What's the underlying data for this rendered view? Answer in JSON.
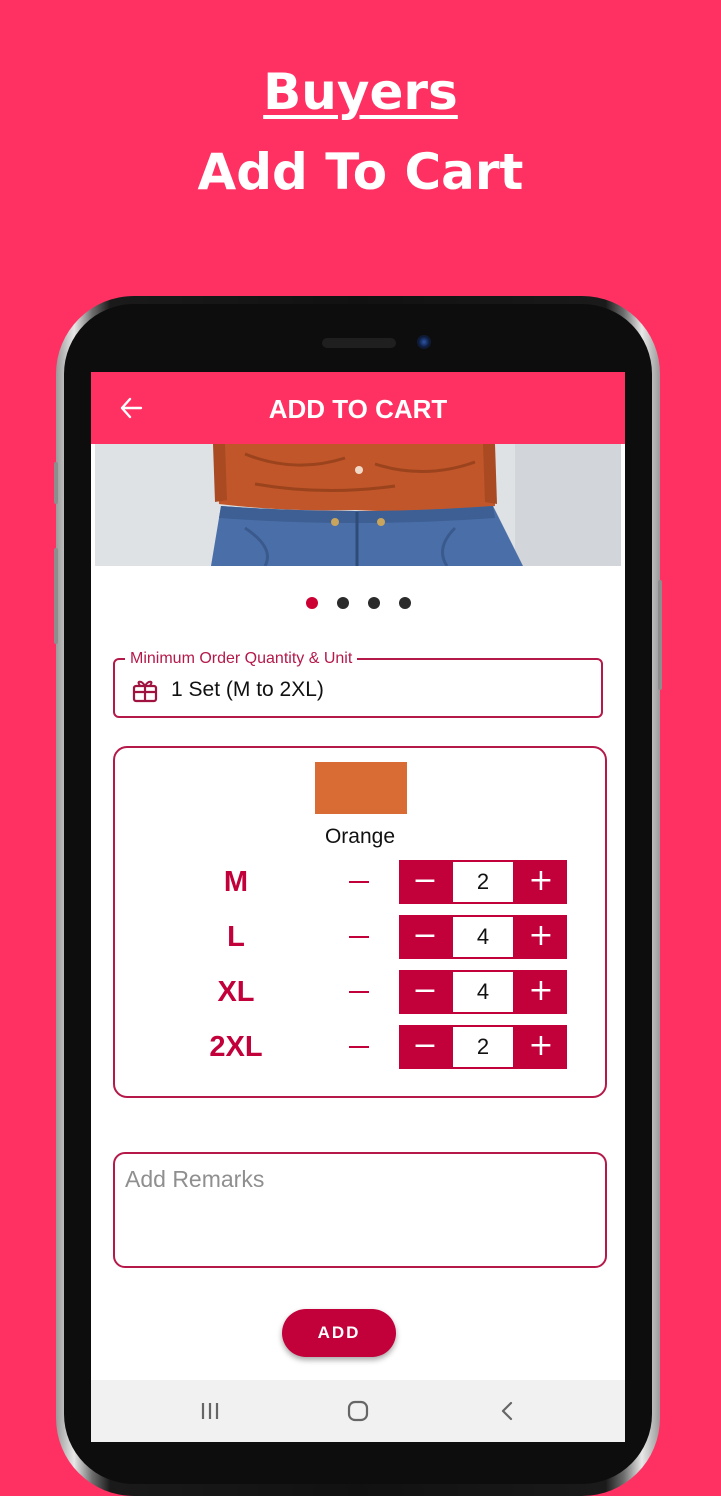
{
  "promo": {
    "line1": "Buyers",
    "line2": "Add To Cart"
  },
  "app_bar": {
    "title": "ADD TO CART",
    "back_icon": "arrow-left-icon"
  },
  "carousel": {
    "count": 4,
    "active_index": 0
  },
  "min_order": {
    "label": "Minimum Order Quantity & Unit",
    "value": "1 Set (M to 2XL)",
    "icon": "gift-icon"
  },
  "variant": {
    "color_name": "Orange",
    "swatch_color": "#d96b34",
    "sizes": [
      {
        "label": "M",
        "quantity": "2"
      },
      {
        "label": "L",
        "quantity": "4"
      },
      {
        "label": "XL",
        "quantity": "4"
      },
      {
        "label": "2XL",
        "quantity": "2"
      }
    ],
    "minus_symbol": "−",
    "plus_symbol": "+"
  },
  "remarks": {
    "placeholder": "Add Remarks",
    "value": ""
  },
  "add_button": {
    "label": "ADD"
  },
  "nav": {
    "recents_icon": "recents-icon",
    "home_icon": "home-icon",
    "back_icon": "back-icon"
  },
  "colors": {
    "primary": "#ff3162",
    "accent": "#c2003a",
    "border": "#b5194a"
  }
}
